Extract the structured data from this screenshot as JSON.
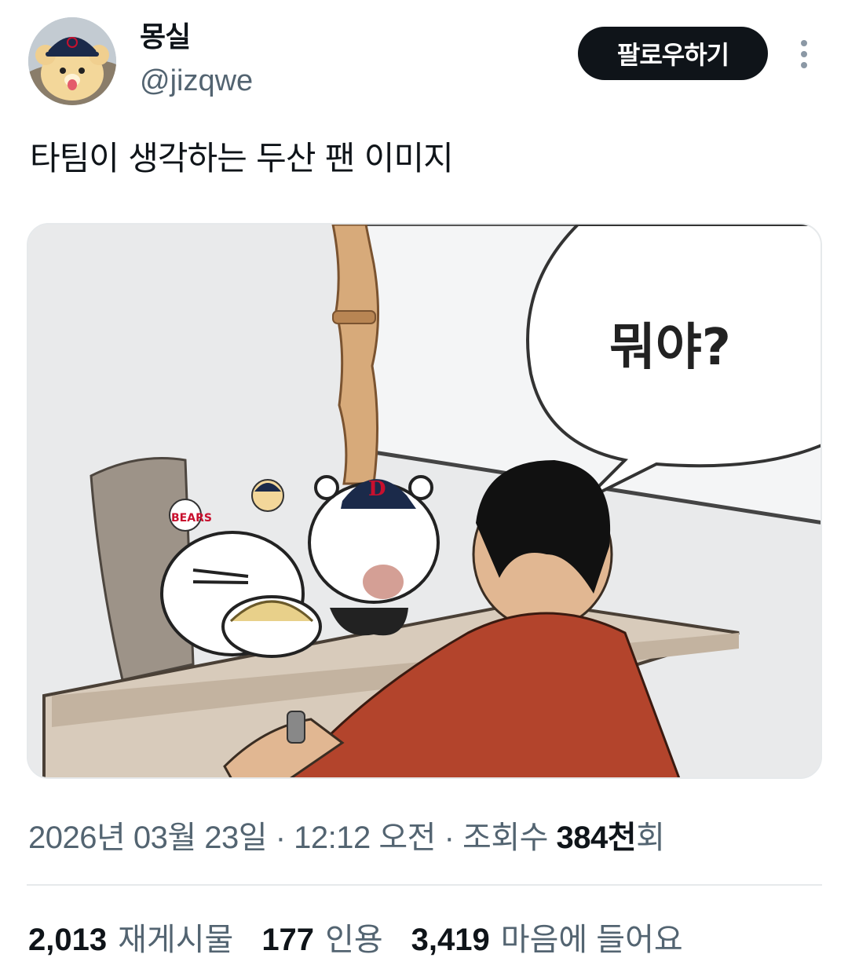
{
  "profile": {
    "display_name": "몽실",
    "handle": "@jizqwe",
    "avatar": "bear-mascot-avatar"
  },
  "actions": {
    "follow_label": "팔로우하기",
    "more_icon": "more-vertical-icon"
  },
  "tweet": {
    "text": "타팀이 생각하는 두산 팬 이미지",
    "media": {
      "speech_bubble_text": "뭐야?",
      "ball_text": "BEARS",
      "cap_letter": "D"
    }
  },
  "meta": {
    "date": "2026년 03월 23일",
    "sep1": " · ",
    "time": "12:12 오전",
    "sep2": " · ",
    "views_label": "조회수 ",
    "views_count": "384천",
    "views_suffix": "회"
  },
  "stats": {
    "reposts_count": "2,013",
    "reposts_label": "재게시물",
    "quotes_count": "177",
    "quotes_label": "인용",
    "likes_count": "3,419",
    "likes_label": "마음에 들어요"
  },
  "colors": {
    "text": "#0f1419",
    "secondary": "#536471",
    "divider": "#e6e9eb",
    "button_bg": "#0f1419"
  }
}
